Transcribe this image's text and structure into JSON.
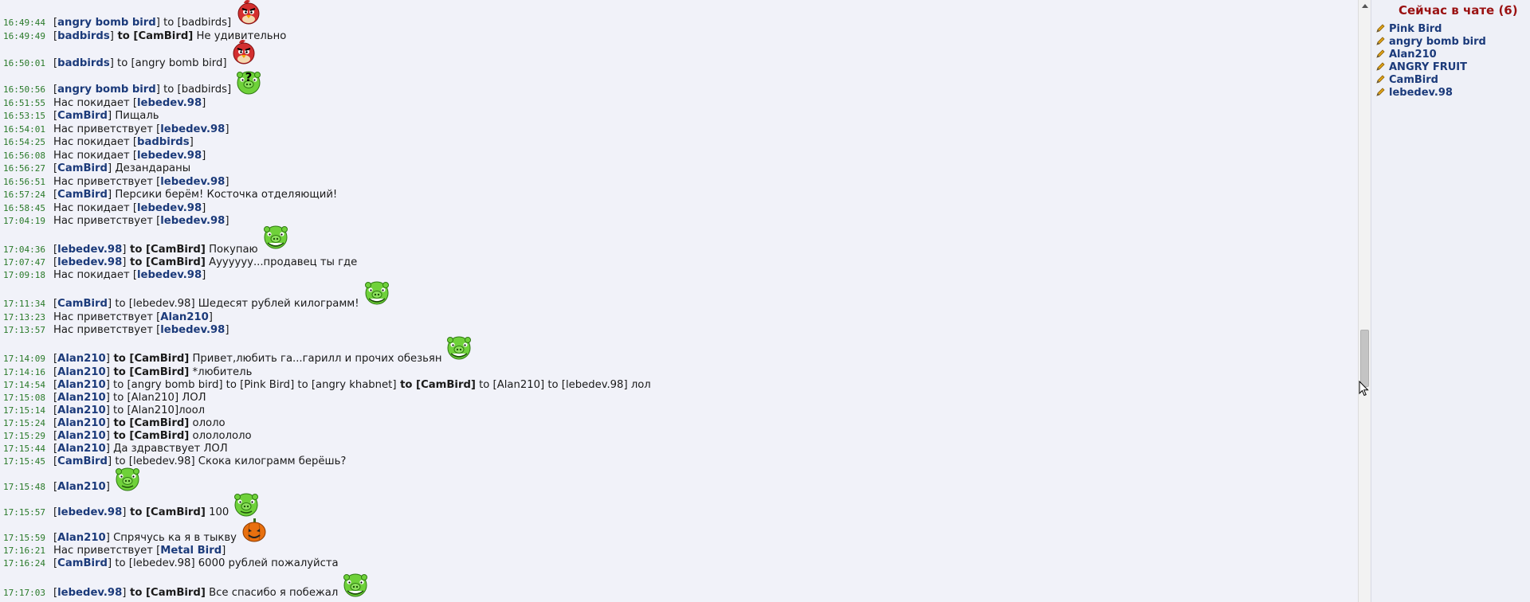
{
  "messages": [
    {
      "time": "16:49:44",
      "sender": "angry bomb bird",
      "to": [
        {
          "n": "badbirds",
          "b": false
        }
      ],
      "text": "",
      "emoji": "red-bird-emoji"
    },
    {
      "time": "16:49:49",
      "sender": "badbirds",
      "to": [
        {
          "n": "CamBird",
          "b": true
        }
      ],
      "text": "Не удивительно",
      "emoji": ""
    },
    {
      "time": "16:50:01",
      "sender": "badbirds",
      "to": [
        {
          "n": "angry bomb bird",
          "b": false
        }
      ],
      "text": "",
      "emoji": "red-bird-emoji"
    },
    {
      "time": "16:50:56",
      "sender": "angry bomb bird",
      "to": [
        {
          "n": "badbirds",
          "b": false
        }
      ],
      "text": "",
      "emoji": "question-pig-emoji"
    },
    {
      "time": "16:51:55",
      "system": "Нас покидает",
      "nick": "lebedev.98"
    },
    {
      "time": "16:53:15",
      "sender": "CamBird",
      "to": [],
      "text": "Пищаль",
      "emoji": ""
    },
    {
      "time": "16:54:01",
      "system": "Нас приветствует",
      "nick": "lebedev.98"
    },
    {
      "time": "16:54:25",
      "system": "Нас покидает",
      "nick": "badbirds"
    },
    {
      "time": "16:56:08",
      "system": "Нас покидает",
      "nick": "lebedev.98"
    },
    {
      "time": "16:56:27",
      "sender": "CamBird",
      "to": [],
      "text": "Дезандараны",
      "emoji": ""
    },
    {
      "time": "16:56:51",
      "system": "Нас приветствует",
      "nick": "lebedev.98"
    },
    {
      "time": "16:57:24",
      "sender": "CamBird",
      "to": [],
      "text": "Персики берём! Косточка отделяющий!",
      "emoji": ""
    },
    {
      "time": "16:58:45",
      "system": "Нас покидает",
      "nick": "lebedev.98"
    },
    {
      "time": "17:04:19",
      "system": "Нас приветствует",
      "nick": "lebedev.98"
    },
    {
      "time": "17:04:36",
      "sender": "lebedev.98",
      "to": [
        {
          "n": "CamBird",
          "b": true
        }
      ],
      "text": "Покупаю",
      "emoji": "troll-pig-emoji"
    },
    {
      "time": "17:07:47",
      "sender": "lebedev.98",
      "to": [
        {
          "n": "CamBird",
          "b": true
        }
      ],
      "text": "Ауууууу...продавец ты где",
      "emoji": ""
    },
    {
      "time": "17:09:18",
      "system": "Нас покидает",
      "nick": "lebedev.98"
    },
    {
      "time": "17:11:34",
      "sender": "CamBird",
      "to": [
        {
          "n": "lebedev.98",
          "b": false
        }
      ],
      "text": "Шедесят рублей килограмм!",
      "emoji": "troll-pig-emoji"
    },
    {
      "time": "17:13:23",
      "system": "Нас приветствует",
      "nick": "Alan210"
    },
    {
      "time": "17:13:57",
      "system": "Нас приветствует",
      "nick": "lebedev.98"
    },
    {
      "time": "17:14:09",
      "sender": "Alan210",
      "to": [
        {
          "n": "CamBird",
          "b": true
        }
      ],
      "text": "Привет,любить га...гарилл и прочих обезьян",
      "emoji": "troll-pig-emoji"
    },
    {
      "time": "17:14:16",
      "sender": "Alan210",
      "to": [
        {
          "n": "CamBird",
          "b": true
        }
      ],
      "text": "*любитель",
      "emoji": ""
    },
    {
      "time": "17:14:54",
      "sender": "Alan210",
      "to": [
        {
          "n": "angry bomb bird",
          "b": false
        },
        {
          "n": "Pink Bird",
          "b": false
        },
        {
          "n": "angry khabnet",
          "b": false
        },
        {
          "n": "CamBird",
          "b": true
        },
        {
          "n": "Alan210",
          "b": false
        },
        {
          "n": "lebedev.98",
          "b": false
        }
      ],
      "text": "лол",
      "emoji": ""
    },
    {
      "time": "17:15:08",
      "sender": "Alan210",
      "to": [
        {
          "n": "Alan210",
          "b": false
        }
      ],
      "text": "ЛОЛ",
      "emoji": ""
    },
    {
      "time": "17:15:14",
      "sender": "Alan210",
      "to": [
        {
          "n": "Alan210",
          "b": false
        }
      ],
      "text": "лоол",
      "emoji": "",
      "nospace": true
    },
    {
      "time": "17:15:24",
      "sender": "Alan210",
      "to": [
        {
          "n": "CamBird",
          "b": true
        }
      ],
      "text": "ололо",
      "emoji": ""
    },
    {
      "time": "17:15:29",
      "sender": "Alan210",
      "to": [
        {
          "n": "CamBird",
          "b": true
        }
      ],
      "text": "ололололо",
      "emoji": ""
    },
    {
      "time": "17:15:44",
      "sender": "Alan210",
      "to": [],
      "text": "Да здравствует ЛОЛ",
      "emoji": ""
    },
    {
      "time": "17:15:45",
      "sender": "CamBird",
      "to": [
        {
          "n": "lebedev.98",
          "b": false
        }
      ],
      "text": "Скока килограмм берёшь?",
      "emoji": ""
    },
    {
      "time": "17:15:48",
      "sender": "Alan210",
      "to": [],
      "text": "",
      "emoji": "smile-pig-emoji"
    },
    {
      "time": "17:15:57",
      "sender": "lebedev.98",
      "to": [
        {
          "n": "CamBird",
          "b": true
        }
      ],
      "text": "100",
      "emoji": "smile-pig-emoji"
    },
    {
      "time": "17:15:59",
      "sender": "Alan210",
      "to": [],
      "text": "Спрячусь ка я в тыкву",
      "emoji": "pumpkin-emoji"
    },
    {
      "time": "17:16:21",
      "system": "Нас приветствует",
      "nick": "Metal Bird"
    },
    {
      "time": "17:16:24",
      "sender": "CamBird",
      "to": [
        {
          "n": "lebedev.98",
          "b": false
        }
      ],
      "text": "6000 рублей пожалуйста",
      "emoji": ""
    },
    {
      "time": "17:17:03",
      "sender": "lebedev.98",
      "to": [
        {
          "n": "CamBird",
          "b": true
        }
      ],
      "text": "Все спасибо я побежал",
      "emoji": "troll-pig-emoji"
    }
  ],
  "users_panel": {
    "title": "Сейчас в чате (6)",
    "users": [
      "Pink Bird",
      "angry bomb bird",
      "Alan210",
      "ANGRY FRUIT",
      "CamBird",
      "lebedev.98"
    ]
  },
  "colors": {
    "timestamp": "#2a7a2a",
    "nick": "#1b3a7a",
    "title": "#9a1111",
    "background": "#f1f2f9"
  }
}
